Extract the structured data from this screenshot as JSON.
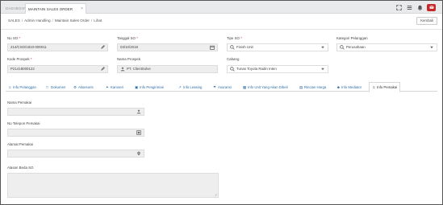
{
  "tabs": {
    "dashboard": "DASHBOARD",
    "active": "MAINTAIN SALES ORDER",
    "close": "×"
  },
  "breadcrumb": [
    "SALES",
    "Admin Handling",
    "Maintain Sales Order",
    "Lihat"
  ],
  "breadcrumb_sep": "/",
  "kembali_label": "Kembali",
  "form": {
    "no_so": {
      "label": "No SO",
      "value": "214/CSO/1810-000011"
    },
    "tanggal_so": {
      "label": "Tanggal SO",
      "value": "03/10/2018"
    },
    "tipe_so": {
      "label": "Tipe SO",
      "value": "Finish Unit"
    },
    "kategori_pelanggan": {
      "label": "Kategori Pelanggan",
      "value": "Perusahaan"
    },
    "kode_prospek": {
      "label": "Kode Prospek",
      "value": "P21418000122"
    },
    "nama_prospek": {
      "label": "Nama Prospek",
      "value": "PT. ClientSolve"
    },
    "cabang": {
      "label": "Cabang",
      "value": "Tunas Toyota Radin Inten"
    },
    "required_mark": "*"
  },
  "detail_tabs": [
    {
      "label": "Info Pelanggan",
      "icon": "user-icon"
    },
    {
      "label": "Dokumen",
      "icon": "folder-icon"
    },
    {
      "label": "Aksesoris",
      "icon": "gear-icon"
    },
    {
      "label": "Karoseri",
      "icon": "wrench-icon"
    },
    {
      "label": "Info Pengiriman",
      "icon": "truck-icon"
    },
    {
      "label": "Info Leasing",
      "icon": "chart-icon"
    },
    {
      "label": "Asuransi",
      "icon": "umbrella-icon"
    },
    {
      "label": "Info Unit Yang Akan Dibeli",
      "icon": "car-icon"
    },
    {
      "label": "Rincian Harga",
      "icon": "money-icon"
    },
    {
      "label": "Info Mediator",
      "icon": "users-icon"
    },
    {
      "label": "Info Pemakai",
      "icon": "user-icon"
    }
  ],
  "pemakai": {
    "nama": {
      "label": "Nama Pemakai",
      "value": ""
    },
    "telepon": {
      "label": "No Telepon Pemakai",
      "value": ""
    },
    "alamat": {
      "label": "Alamat Pemakai",
      "value": ""
    },
    "alasan": {
      "label": "Alasan Beda SO",
      "value": ""
    }
  },
  "colors": {
    "link": "#2f6ea5",
    "required": "#d32f2f",
    "accent_red": "#c62828"
  }
}
